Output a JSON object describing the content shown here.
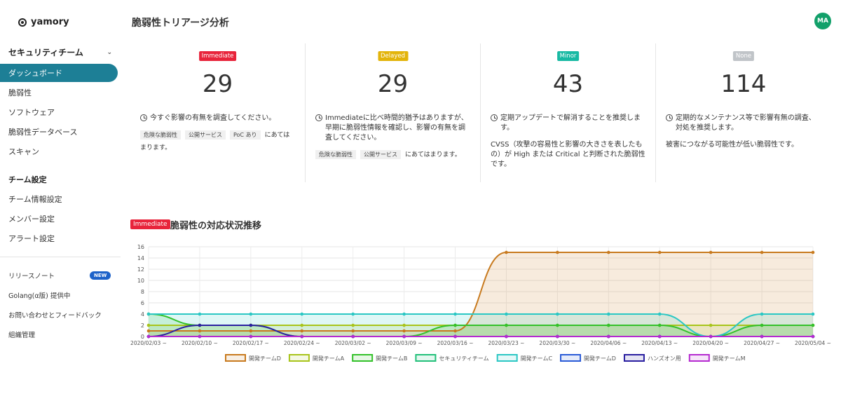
{
  "sidebar": {
    "brand": "yamory",
    "team_name": "セキュリティチーム",
    "nav": [
      {
        "label": "ダッシュボード",
        "active": true
      },
      {
        "label": "脆弱性"
      },
      {
        "label": "ソフトウェア"
      },
      {
        "label": "脆弱性データベース"
      },
      {
        "label": "スキャン"
      }
    ],
    "team_settings_title": "チーム設定",
    "team_settings": [
      {
        "label": "チーム情報設定"
      },
      {
        "label": "メンバー設定"
      },
      {
        "label": "アラート設定"
      }
    ],
    "footer": [
      {
        "label": "リリースノート"
      },
      {
        "label": "Golang(α版) 提供中"
      },
      {
        "label": "お問い合わせとフィードバック"
      },
      {
        "label": "組織管理"
      }
    ],
    "new_badge": "NEW"
  },
  "header": {
    "title": "脆弱性トリアージ分析",
    "avatar": "MA"
  },
  "cards": [
    {
      "badge": "Immediate",
      "color": "#e8243b",
      "count": "29",
      "desc": "今すぐ影響の有無を調査してください。",
      "tags": [
        "危険な脆弱性",
        "公開サービス",
        "PoC あり"
      ],
      "tags_suffix": "にあてはまります。",
      "extra": ""
    },
    {
      "badge": "Delayed",
      "color": "#e3b40b",
      "count": "29",
      "desc": "Immediateに比べ時間的猶予はありますが、早期に脆弱性情報を確認し、影響の有無を調査してください。",
      "tags": [
        "危険な脆弱性",
        "公開サービス"
      ],
      "tags_suffix": "にあてはまります。",
      "extra": ""
    },
    {
      "badge": "Minor",
      "color": "#18b9a3",
      "count": "43",
      "desc": "定期アップデートで解消することを推奨します。",
      "tags": [],
      "tags_suffix": "",
      "extra": "CVSS（攻撃の容易性と影響の大きさを表したもの）が High または Critical と判断された脆弱性です。"
    },
    {
      "badge": "None",
      "color": "#c0c4c8",
      "count": "114",
      "desc": "定期的なメンテナンス等で影響有無の調査、対処を推奨します。",
      "tags": [],
      "tags_suffix": "",
      "extra": "被害につながる可能性が低い脆弱性です。"
    }
  ],
  "chart_section": {
    "badge": "Immediate",
    "title": "脆弱性の対応状況推移"
  },
  "chart_data": {
    "type": "line",
    "categories": [
      "2020/02/03 ~",
      "2020/02/10 ~",
      "2020/02/17 ~",
      "2020/02/24 ~",
      "2020/03/02 ~",
      "2020/03/09 ~",
      "2020/03/16 ~",
      "2020/03/23 ~",
      "2020/03/30 ~",
      "2020/04/06 ~",
      "2020/04/13 ~",
      "2020/04/20 ~",
      "2020/04/27 ~",
      "2020/05/04 ~"
    ],
    "ylim": [
      0,
      16
    ],
    "yticks": [
      0,
      2,
      4,
      6,
      8,
      10,
      12,
      14,
      16
    ],
    "grid": true,
    "legend": "bottom",
    "series": [
      {
        "name": "開発チームD",
        "color": "#c87a1e",
        "fill": true,
        "values": [
          1,
          1,
          1,
          1,
          1,
          1,
          1,
          15,
          15,
          15,
          15,
          15,
          15,
          15
        ]
      },
      {
        "name": "開発チームA",
        "color": "#a8c41a",
        "fill": true,
        "values": [
          2,
          2,
          2,
          2,
          2,
          2,
          2,
          2,
          2,
          2,
          2,
          2,
          2,
          2
        ]
      },
      {
        "name": "開発チームB",
        "color": "#33c12a",
        "fill": true,
        "values": [
          4,
          2,
          2,
          0,
          0,
          0,
          2,
          2,
          2,
          2,
          2,
          0,
          2,
          2
        ]
      },
      {
        "name": "セキュリティチーム",
        "color": "#22c07a",
        "fill": false,
        "values": [
          0,
          0,
          0,
          0,
          0,
          0,
          0,
          0,
          0,
          0,
          0,
          0,
          0,
          0
        ]
      },
      {
        "name": "開発チームC",
        "color": "#2bc7c4",
        "fill": true,
        "values": [
          4,
          4,
          4,
          4,
          4,
          4,
          4,
          4,
          4,
          4,
          4,
          0,
          4,
          4
        ]
      },
      {
        "name": "開発チームD",
        "color": "#2a5bd7",
        "fill": false,
        "values": [
          0,
          0,
          0,
          0,
          0,
          0,
          0,
          0,
          0,
          0,
          0,
          0,
          0,
          0
        ]
      },
      {
        "name": "ハンズオン用",
        "color": "#2a1fa0",
        "fill": false,
        "values": [
          0,
          2,
          2,
          0,
          0,
          0,
          0,
          0,
          0,
          0,
          0,
          0,
          0,
          0
        ]
      },
      {
        "name": "開発チームM",
        "color": "#b52ad0",
        "fill": false,
        "values": [
          0,
          0,
          0,
          0,
          0,
          0,
          0,
          0,
          0,
          0,
          0,
          0,
          0,
          0
        ]
      }
    ]
  }
}
